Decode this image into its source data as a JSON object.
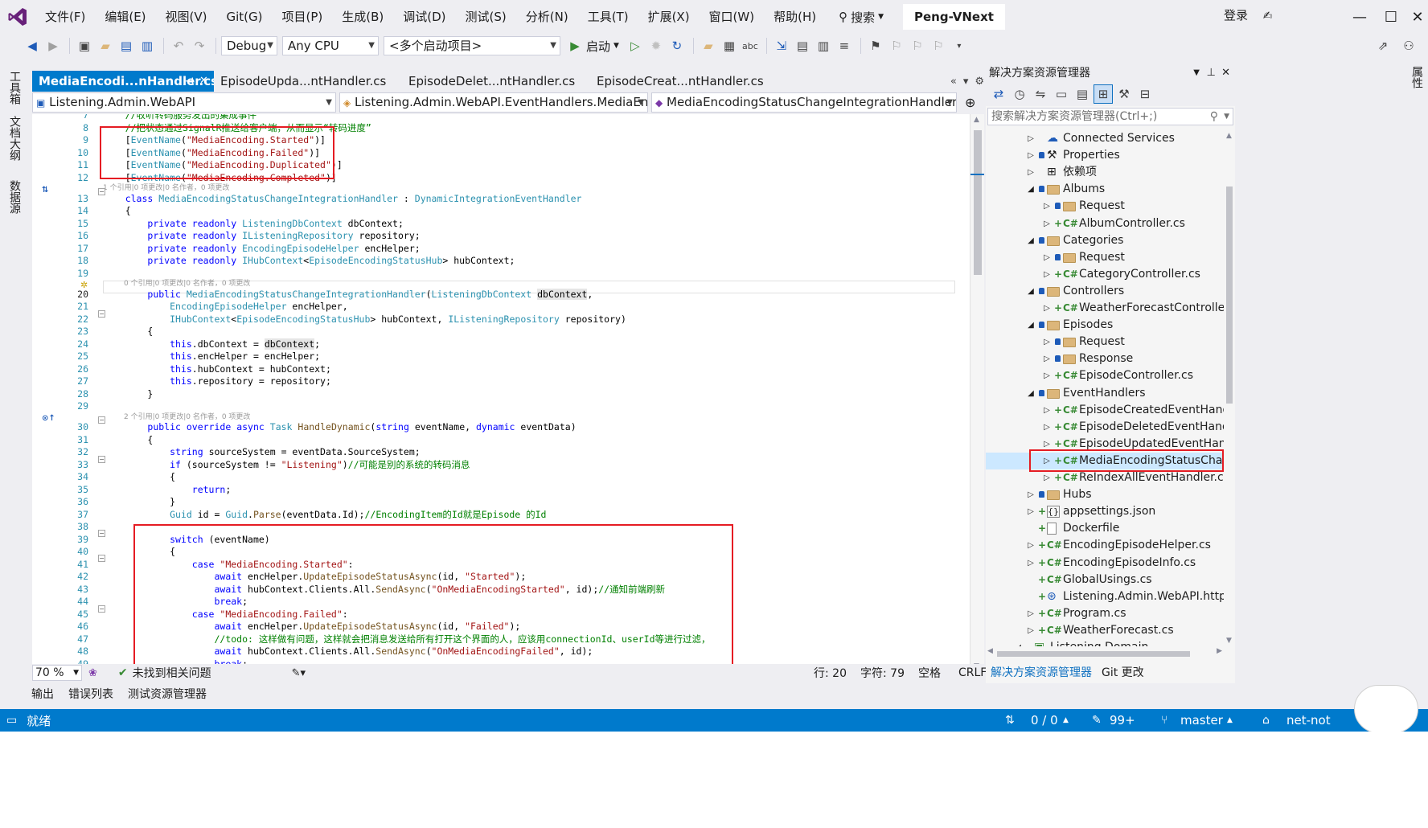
{
  "menubar": {
    "items": [
      "文件(F)",
      "编辑(E)",
      "视图(V)",
      "Git(G)",
      "项目(P)",
      "生成(B)",
      "调试(D)",
      "测试(S)",
      "分析(N)",
      "工具(T)",
      "扩展(X)",
      "窗口(W)",
      "帮助(H)"
    ],
    "search_label": "搜索",
    "solution_title": "Peng-VNext",
    "login": "登录"
  },
  "toolbar": {
    "config": "Debug",
    "platform": "Any CPU",
    "startup_projects": "<多个启动项目>",
    "start_label": "启动"
  },
  "left_strip": [
    "工具箱",
    "文档大纲",
    "数据源"
  ],
  "right_strip": [
    "属性"
  ],
  "doc_tabs": [
    {
      "label": "MediaEncodi...nHandler.cs",
      "active": true
    },
    {
      "label": "EpisodeUpda...ntHandler.cs",
      "active": false
    },
    {
      "label": "EpisodeDelet...ntHandler.cs",
      "active": false
    },
    {
      "label": "EpisodeCreat...ntHandler.cs",
      "active": false
    }
  ],
  "navbar": {
    "project": "Listening.Admin.WebAPI",
    "type": "Listening.Admin.WebAPI.EventHandlers.MediaEncodi",
    "member": "MediaEncodingStatusChangeIntegrationHandler(Liste"
  },
  "editor": {
    "lens_a": "1 个引用|0 项更改|0 名作者，0 项更改",
    "lens_b": "0 个引用|0 项更改|0 名作者，0 项更改",
    "lens_c": "2 个引用|0 项更改|0 名作者，0 项更改",
    "lines": [
      {
        "n": "7",
        "t": "    //收听转码服务发出的集成事件"
      },
      {
        "n": "8",
        "t": "    //把状态通过SignalR推送给客户端，从而显示“转码进度”"
      },
      {
        "n": "9",
        "t": "    [EventName(\"MediaEncoding.Started\")]"
      },
      {
        "n": "10",
        "t": "    [EventName(\"MediaEncoding.Failed\")]"
      },
      {
        "n": "11",
        "t": "    [EventName(\"MediaEncoding.Duplicated\")]"
      },
      {
        "n": "12",
        "t": "    [EventName(\"MediaEncoding.Completed\")]"
      },
      {
        "n": "13",
        "t": "    class MediaEncodingStatusChangeIntegrationHandler : DynamicIntegrationEventHandler"
      },
      {
        "n": "14",
        "t": "    {"
      },
      {
        "n": "15",
        "t": "        private readonly ListeningDbContext dbContext;"
      },
      {
        "n": "16",
        "t": "        private readonly IListeningRepository repository;"
      },
      {
        "n": "17",
        "t": "        private readonly EncodingEpisodeHelper encHelper;"
      },
      {
        "n": "18",
        "t": "        private readonly IHubContext<EpisodeEncodingStatusHub> hubContext;"
      },
      {
        "n": "19",
        "t": ""
      },
      {
        "n": "20",
        "t": "        public MediaEncodingStatusChangeIntegrationHandler(ListeningDbContext dbContext,"
      },
      {
        "n": "21",
        "t": "            EncodingEpisodeHelper encHelper,"
      },
      {
        "n": "22",
        "t": "            IHubContext<EpisodeEncodingStatusHub> hubContext, IListeningRepository repository)"
      },
      {
        "n": "23",
        "t": "        {"
      },
      {
        "n": "24",
        "t": "            this.dbContext = dbContext;"
      },
      {
        "n": "25",
        "t": "            this.encHelper = encHelper;"
      },
      {
        "n": "26",
        "t": "            this.hubContext = hubContext;"
      },
      {
        "n": "27",
        "t": "            this.repository = repository;"
      },
      {
        "n": "28",
        "t": "        }"
      },
      {
        "n": "29",
        "t": ""
      },
      {
        "n": "30",
        "t": "        public override async Task HandleDynamic(string eventName, dynamic eventData)"
      },
      {
        "n": "31",
        "t": "        {"
      },
      {
        "n": "32",
        "t": "            string sourceSystem = eventData.SourceSystem;"
      },
      {
        "n": "33",
        "t": "            if (sourceSystem != \"Listening\")//可能是别的系统的转码消息"
      },
      {
        "n": "34",
        "t": "            {"
      },
      {
        "n": "35",
        "t": "                return;"
      },
      {
        "n": "36",
        "t": "            }"
      },
      {
        "n": "37",
        "t": "            Guid id = Guid.Parse(eventData.Id);//EncodingItem的Id就是Episode 的Id"
      },
      {
        "n": "38",
        "t": ""
      },
      {
        "n": "39",
        "t": "            switch (eventName)"
      },
      {
        "n": "40",
        "t": "            {"
      },
      {
        "n": "41",
        "t": "                case \"MediaEncoding.Started\":"
      },
      {
        "n": "42",
        "t": "                    await encHelper.UpdateEpisodeStatusAsync(id, \"Started\");"
      },
      {
        "n": "43",
        "t": "                    await hubContext.Clients.All.SendAsync(\"OnMediaEncodingStarted\", id);//通知前端刷新"
      },
      {
        "n": "44",
        "t": "                    break;"
      },
      {
        "n": "45",
        "t": "                case \"MediaEncoding.Failed\":"
      },
      {
        "n": "46",
        "t": "                    await encHelper.UpdateEpisodeStatusAsync(id, \"Failed\");"
      },
      {
        "n": "47",
        "t": "                    //todo: 这样做有问题，这样就会把消息发送给所有打开这个界面的人，应该用connectionId、userId等进行过滤，"
      },
      {
        "n": "48",
        "t": "                    await hubContext.Clients.All.SendAsync(\"OnMediaEncodingFailed\", id);"
      },
      {
        "n": "49",
        "t": "                    break;"
      }
    ]
  },
  "editor_status": {
    "zoom": "70 %",
    "issues": "未找到相关问题",
    "line": "行: 20",
    "col": "字符: 79",
    "spaces": "空格",
    "eol": "CRLF"
  },
  "bottom_tabs": [
    "输出",
    "错误列表",
    "测试资源管理器"
  ],
  "statusbar": {
    "ready": "就绪",
    "changes": "0 / 0",
    "edits": "99+",
    "branch": "master",
    "repo": "net-not"
  },
  "solution_explorer": {
    "title": "解决方案资源管理器",
    "search_placeholder": "搜索解决方案资源管理器(Ctrl+;)",
    "items": [
      {
        "label": "Connected Services",
        "depth": 0,
        "exp": "▷",
        "icon": "connected-services-icon"
      },
      {
        "label": "Properties",
        "depth": 0,
        "exp": "▷",
        "icon": "properties-icon"
      },
      {
        "label": "依赖项",
        "depth": 0,
        "exp": "▷",
        "icon": "dependencies-icon"
      },
      {
        "label": "Albums",
        "depth": 0,
        "exp": "◢",
        "icon": "folder-icon"
      },
      {
        "label": "Request",
        "depth": 1,
        "exp": "▷",
        "icon": "folder-icon"
      },
      {
        "label": "AlbumController.cs",
        "depth": 1,
        "exp": "▷",
        "icon": "csharp-file-icon"
      },
      {
        "label": "Categories",
        "depth": 0,
        "exp": "◢",
        "icon": "folder-icon"
      },
      {
        "label": "Request",
        "depth": 1,
        "exp": "▷",
        "icon": "folder-icon"
      },
      {
        "label": "CategoryController.cs",
        "depth": 1,
        "exp": "▷",
        "icon": "csharp-file-icon"
      },
      {
        "label": "Controllers",
        "depth": 0,
        "exp": "◢",
        "icon": "folder-icon"
      },
      {
        "label": "WeatherForecastController",
        "depth": 1,
        "exp": "▷",
        "icon": "csharp-file-icon"
      },
      {
        "label": "Episodes",
        "depth": 0,
        "exp": "◢",
        "icon": "folder-icon"
      },
      {
        "label": "Request",
        "depth": 1,
        "exp": "▷",
        "icon": "folder-icon"
      },
      {
        "label": "Response",
        "depth": 1,
        "exp": "▷",
        "icon": "folder-icon"
      },
      {
        "label": "EpisodeController.cs",
        "depth": 1,
        "exp": "▷",
        "icon": "csharp-file-icon"
      },
      {
        "label": "EventHandlers",
        "depth": 0,
        "exp": "◢",
        "icon": "folder-icon"
      },
      {
        "label": "EpisodeCreatedEventHandl",
        "depth": 1,
        "exp": "▷",
        "icon": "csharp-file-icon"
      },
      {
        "label": "EpisodeDeletedEventHandl",
        "depth": 1,
        "exp": "▷",
        "icon": "csharp-file-icon"
      },
      {
        "label": "EpisodeUpdatedEventHanc",
        "depth": 1,
        "exp": "▷",
        "icon": "csharp-file-icon"
      },
      {
        "label": "MediaEncodingStatusChan",
        "depth": 1,
        "exp": "▷",
        "icon": "csharp-file-icon",
        "selected": true
      },
      {
        "label": "ReIndexAllEventHandler.cs",
        "depth": 1,
        "exp": "▷",
        "icon": "csharp-file-icon"
      },
      {
        "label": "Hubs",
        "depth": 0,
        "exp": "▷",
        "icon": "folder-icon"
      },
      {
        "label": "appsettings.json",
        "depth": 0,
        "exp": "▷",
        "icon": "json-file-icon"
      },
      {
        "label": "Dockerfile",
        "depth": 0,
        "exp": "",
        "icon": "file-icon"
      },
      {
        "label": "EncodingEpisodeHelper.cs",
        "depth": 0,
        "exp": "▷",
        "icon": "csharp-file-icon"
      },
      {
        "label": "EncodingEpisodeInfo.cs",
        "depth": 0,
        "exp": "▷",
        "icon": "csharp-file-icon"
      },
      {
        "label": "GlobalUsings.cs",
        "depth": 0,
        "exp": "",
        "icon": "csharp-file-icon"
      },
      {
        "label": "Listening.Admin.WebAPI.http",
        "depth": 0,
        "exp": "",
        "icon": "http-file-icon"
      },
      {
        "label": "Program.cs",
        "depth": 0,
        "exp": "▷",
        "icon": "csharp-file-icon"
      },
      {
        "label": "WeatherForecast.cs",
        "depth": 0,
        "exp": "▷",
        "icon": "csharp-file-icon"
      },
      {
        "label": "Listening.Domain",
        "depth": -1,
        "exp": "◢",
        "icon": "project-icon"
      }
    ],
    "bottom_tabs": [
      "解决方案资源管理器",
      "Git 更改"
    ]
  },
  "colors": {
    "accent": "#007acc",
    "highlight_box": "#e51c23",
    "selected_row": "#cce8ff"
  }
}
